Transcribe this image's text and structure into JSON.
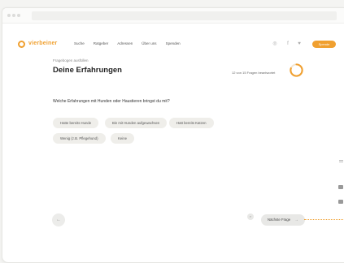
{
  "nav": {
    "brand": "vierbeiner",
    "menu": [
      "Suche",
      "Ratgeber",
      "Adressen",
      "Über uns",
      "Spenden"
    ],
    "icons": [
      "info-icon",
      "facebook-icon",
      "twitter-icon"
    ],
    "cta": "Spende"
  },
  "page": {
    "subtitle": "Fragebogen ausfüllen",
    "title": "Deine Erfahrungen",
    "counter": "12 von 15 Fragen beantwortet",
    "progress": 0.8
  },
  "question": {
    "text": "Welche Erfahrungen mit Hunden oder Haustieren bringst du mit?",
    "options": [
      "Hatte bereits Hunde",
      "Bin mit Hunden aufgewachsen",
      "Hatt bereits Katzen",
      "Wenig (z.B. Pflegehund)",
      "Keine"
    ]
  },
  "footer": {
    "back_symbol": "←",
    "next_label": "Nächste Frage",
    "next_arrow": "→"
  },
  "colors": {
    "accent": "#f0a030",
    "chip_bg": "#efeeea"
  }
}
